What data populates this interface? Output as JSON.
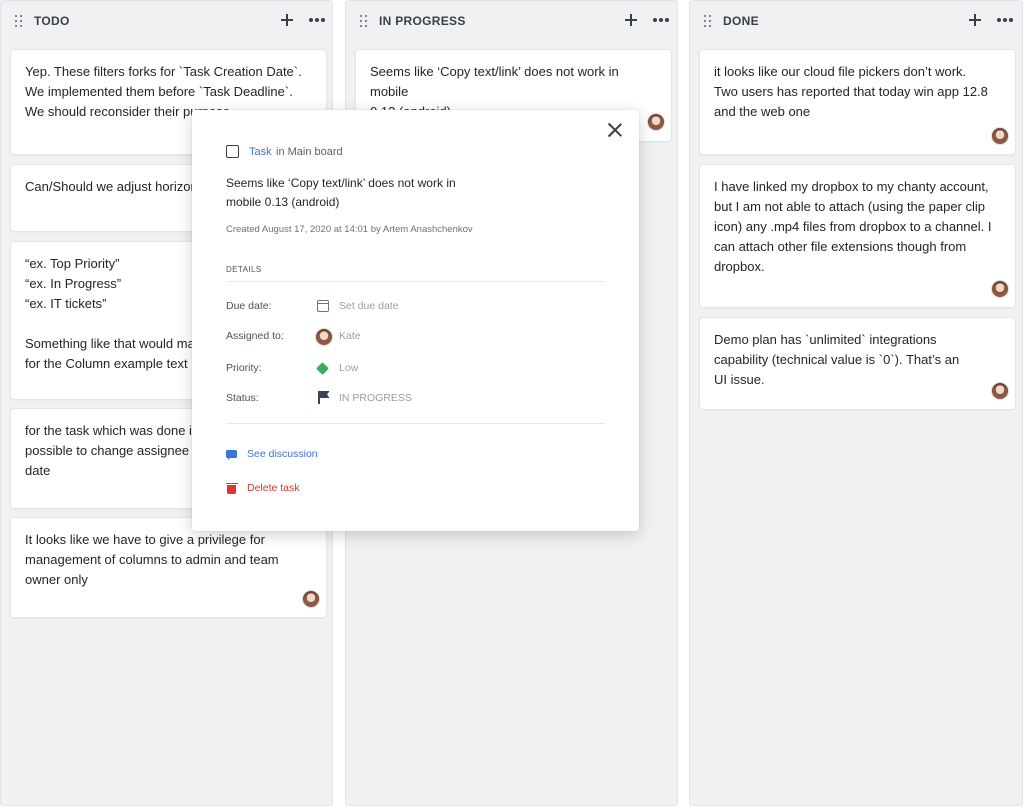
{
  "columns": [
    {
      "title": "TODO",
      "cards": [
        {
          "text": "Yep. These filters forks for `Task Creation Date`.\nWe implemented them before `Task Deadline`.\nWe should reconsider their purpose"
        },
        {
          "text": "Can/Should we adjust horizontal"
        },
        {
          "text": "“ex. Top Priority”\n“ex. In Progress”\n“ex. IT tickets”\n\nSomething like that would make\nfor the Column example text"
        },
        {
          "text": "for the task which was done it\npossible to change assignee a\ndate"
        },
        {
          "text": "It looks like we have to give a privilege for\nmanagement of columns to admin and team\nowner only"
        }
      ]
    },
    {
      "title": "IN PROGRESS",
      "cards": [
        {
          "text": "Seems like ‘Copy text/link’ does not work in mobile\n0.13 (android)"
        }
      ]
    },
    {
      "title": "DONE",
      "cards": [
        {
          "text": "it looks like our cloud file pickers don’t work.\nTwo users has reported that today win app 12.8\nand the web one"
        },
        {
          "text": "I have linked my dropbox to my chanty account,\nbut I am not able to attach (using the paper clip\nicon) any .mp4 files from dropbox to a channel. I\ncan attach other file extensions though from\ndropbox."
        },
        {
          "text": "Demo plan has `unlimited` integrations\ncapability (technical value is `0`). That’s an\nUI issue."
        }
      ]
    }
  ],
  "modal": {
    "task_type": "Task",
    "board": "in Main board",
    "title": "Seems like ‘Copy text/link’ does not work in mobile 0.13 (android)",
    "created": "Created August 17, 2020 at 14:01 by Artem Anashchenkov",
    "details_label": "DETAILS",
    "fields": {
      "due_label": "Due date:",
      "due_value": "Set due date",
      "assigned_label": "Assigned to:",
      "assigned_value": "Kate",
      "priority_label": "Priority:",
      "priority_value": "Low",
      "status_label": "Status:",
      "status_value": "IN PROGRESS"
    },
    "see_discussion": "See discussion",
    "delete_task": "Delete task"
  },
  "icons": [
    "drag-handle-icon",
    "plus-icon",
    "more-icon",
    "close-icon",
    "checkbox-icon",
    "calendar-icon",
    "avatar",
    "diamond-icon",
    "flag-icon",
    "chat-icon",
    "trash-icon"
  ],
  "colors": {
    "accent": "#3b73d6",
    "danger": "#e0362f",
    "priority_low": "#3dab5b",
    "column_bg": "#f0f1f3"
  }
}
